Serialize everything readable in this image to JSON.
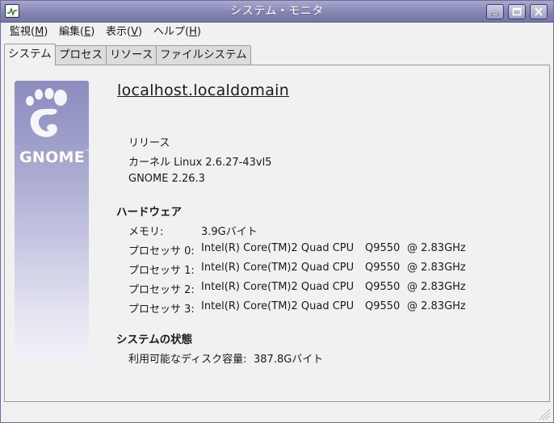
{
  "window": {
    "title": "システム・モニタ",
    "buttons": {
      "minimize": "minimize-icon",
      "maximize": "maximize-icon",
      "close": "close-icon"
    }
  },
  "menubar": {
    "items": [
      {
        "label": "監視(",
        "mnemonic": "M",
        "suffix": ")"
      },
      {
        "label": "編集(",
        "mnemonic": "E",
        "suffix": ")"
      },
      {
        "label": "表示(",
        "mnemonic": "V",
        "suffix": ")"
      },
      {
        "label": "ヘルプ(",
        "mnemonic": "H",
        "suffix": ")"
      }
    ]
  },
  "tabs": [
    {
      "label": "システム",
      "active": true
    },
    {
      "label": "プロセス",
      "active": false
    },
    {
      "label": "リソース",
      "active": false
    },
    {
      "label": "ファイルシステム",
      "active": false
    }
  ],
  "system": {
    "hostname": "localhost.localdomain",
    "logo_text": "GNOME",
    "logo_tm": "™",
    "release_label": "リリース",
    "kernel": "カーネル Linux 2.6.27-43vl5",
    "gnome_version": "GNOME 2.26.3"
  },
  "hardware": {
    "heading": "ハードウェア",
    "memory_label": "メモリ:",
    "memory_value": "3.9Gバイト",
    "processors": [
      {
        "label": "プロセッサ 0:",
        "model": "Intel(R) Core(TM)2 Quad CPU",
        "part": "Q9550",
        "freq": "@ 2.83GHz"
      },
      {
        "label": "プロセッサ 1:",
        "model": "Intel(R) Core(TM)2 Quad CPU",
        "part": "Q9550",
        "freq": "@ 2.83GHz"
      },
      {
        "label": "プロセッサ 2:",
        "model": "Intel(R) Core(TM)2 Quad CPU",
        "part": "Q9550",
        "freq": "@ 2.83GHz"
      },
      {
        "label": "プロセッサ 3:",
        "model": "Intel(R) Core(TM)2 Quad CPU",
        "part": "Q9550",
        "freq": "@ 2.83GHz"
      }
    ]
  },
  "status": {
    "heading": "システムの状態",
    "disk_label": "利用可能なディスク容量:",
    "disk_value": "387.8Gバイト"
  },
  "colors": {
    "titlebar": "#8585b3",
    "banner_top": "#8c8cbe",
    "background": "#f1f1f1"
  }
}
